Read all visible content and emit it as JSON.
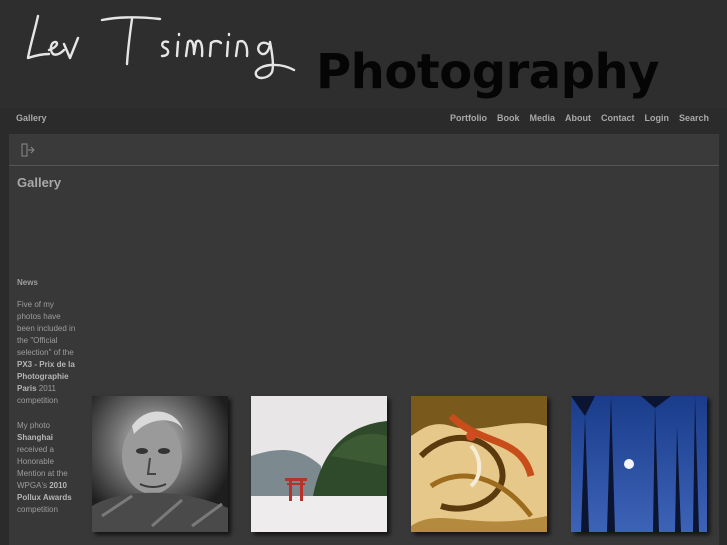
{
  "header": {
    "signature": "Lev Tsimring",
    "title": "Photography"
  },
  "nav": {
    "current": "Gallery",
    "links": [
      "Portfolio",
      "Book",
      "Media",
      "About",
      "Contact",
      "Login",
      "Search"
    ]
  },
  "main": {
    "title": "Gallery",
    "news": {
      "heading": "News",
      "item1": {
        "pre": "Five of my photos have been included in the \"Official selection\" of the ",
        "bold": "PX3 - Prix de la Photographie Paris",
        "post": " 2011 competition"
      },
      "item2": {
        "pre": "My photo ",
        "bold1": "Shanghai",
        "mid": " received a Honorable Mention at the WPGA's ",
        "bold2": "2010 Pollux Awards",
        "post": " competition"
      }
    }
  },
  "thumbnails": [
    {
      "subject": "portrait of elderly man"
    },
    {
      "subject": "red torii gate by lake"
    },
    {
      "subject": "abstract swirls"
    },
    {
      "subject": "palm trees at night with moon"
    }
  ],
  "colors": {
    "background": "#2b2b2b",
    "panel": "#383838",
    "text": "#a8a8a8",
    "title": "#050505"
  }
}
